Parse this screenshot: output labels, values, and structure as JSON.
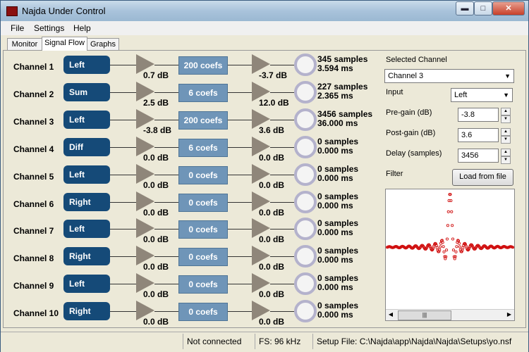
{
  "window": {
    "title": "Najda Under Control"
  },
  "window_controls": {
    "minimize": "▬",
    "maximize": "□",
    "close": "✕"
  },
  "menu": [
    "File",
    "Settings",
    "Help"
  ],
  "tabs": [
    {
      "label": "Monitor",
      "active": false
    },
    {
      "label": "Signal Flow",
      "active": true
    },
    {
      "label": "Graphs",
      "active": false
    }
  ],
  "channels": [
    {
      "name": "Channel 1",
      "input": "Left",
      "pre_gain": "0.7 dB",
      "filter": "200 coefs",
      "post_gain": "-3.7 dB",
      "delay_samples": "345 samples",
      "delay_ms": "3.594 ms"
    },
    {
      "name": "Channel 2",
      "input": "Sum",
      "pre_gain": "2.5 dB",
      "filter": "6 coefs",
      "post_gain": "12.0 dB",
      "delay_samples": "227 samples",
      "delay_ms": "2.365 ms"
    },
    {
      "name": "Channel 3",
      "input": "Left",
      "pre_gain": "-3.8 dB",
      "filter": "200 coefs",
      "post_gain": "3.6 dB",
      "delay_samples": "3456 samples",
      "delay_ms": "36.000 ms"
    },
    {
      "name": "Channel 4",
      "input": "Diff",
      "pre_gain": "0.0 dB",
      "filter": "6 coefs",
      "post_gain": "0.0 dB",
      "delay_samples": "0 samples",
      "delay_ms": "0.000 ms"
    },
    {
      "name": "Channel 5",
      "input": "Left",
      "pre_gain": "0.0 dB",
      "filter": "0 coefs",
      "post_gain": "0.0 dB",
      "delay_samples": "0 samples",
      "delay_ms": "0.000 ms"
    },
    {
      "name": "Channel 6",
      "input": "Right",
      "pre_gain": "0.0 dB",
      "filter": "0 coefs",
      "post_gain": "0.0 dB",
      "delay_samples": "0 samples",
      "delay_ms": "0.000 ms"
    },
    {
      "name": "Channel 7",
      "input": "Left",
      "pre_gain": "0.0 dB",
      "filter": "0 coefs",
      "post_gain": "0.0 dB",
      "delay_samples": "0 samples",
      "delay_ms": "0.000 ms"
    },
    {
      "name": "Channel 8",
      "input": "Right",
      "pre_gain": "0.0 dB",
      "filter": "0 coefs",
      "post_gain": "0.0 dB",
      "delay_samples": "0 samples",
      "delay_ms": "0.000 ms"
    },
    {
      "name": "Channel 9",
      "input": "Left",
      "pre_gain": "0.0 dB",
      "filter": "0 coefs",
      "post_gain": "0.0 dB",
      "delay_samples": "0 samples",
      "delay_ms": "0.000 ms"
    },
    {
      "name": "Channel 10",
      "input": "Right",
      "pre_gain": "0.0 dB",
      "filter": "0 coefs",
      "post_gain": "0.0 dB",
      "delay_samples": "0 samples",
      "delay_ms": "0.000 ms"
    }
  ],
  "selected": {
    "group_label": "Selected Channel",
    "channel_value": "Channel 3",
    "input_label": "Input",
    "input_value": "Left",
    "pre_gain_label": "Pre-gain (dB)",
    "pre_gain_value": "-3.8",
    "post_gain_label": "Post-gain (dB)",
    "post_gain_value": "3.6",
    "delay_label": "Delay (samples)",
    "delay_value": "3456",
    "filter_label": "Filter",
    "load_button": "Load from file",
    "scroll_thumb": "|||"
  },
  "status": {
    "connection": "Not connected",
    "sample_rate": "FS: 96 kHz",
    "setup_file": "Setup File: C:\\Najda\\app\\Najda\\Najda\\Setups\\yo.nsf"
  },
  "colors": {
    "pill": "#154a78",
    "coef_box": "#6f95b8",
    "filter_plot": "#d01010"
  }
}
